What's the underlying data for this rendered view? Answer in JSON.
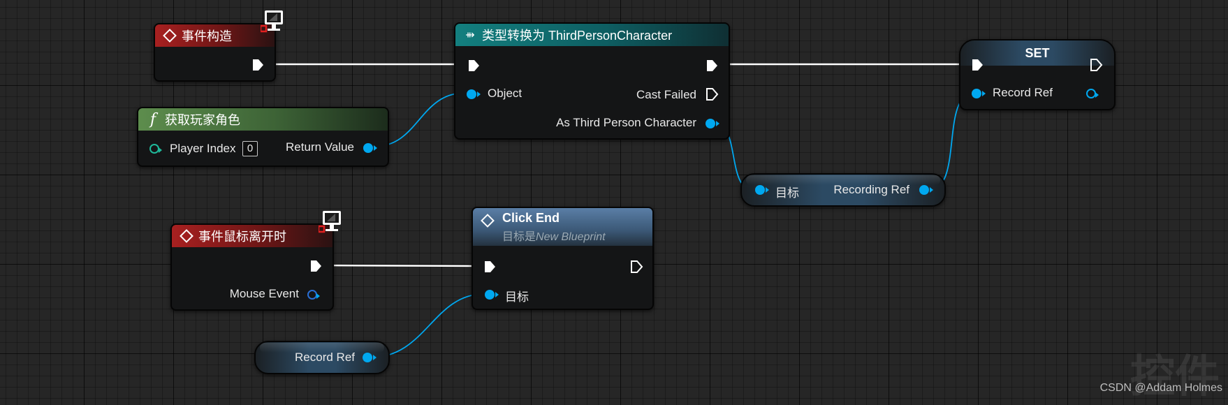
{
  "nodes": {
    "event_construct": {
      "title": "事件构造"
    },
    "cast": {
      "title": "类型转换为 ThirdPersonCharacter",
      "pin_object": "Object",
      "pin_cast_failed": "Cast Failed",
      "pin_as": "As Third Person Character"
    },
    "get_player": {
      "title": "获取玩家角色",
      "pin_player_index": "Player Index",
      "player_index_value": "0",
      "pin_return": "Return Value"
    },
    "set": {
      "title": "SET",
      "pin_record_ref": "Record Ref"
    },
    "recording_getter": {
      "pin_target": "目标",
      "pin_recording_ref": "Recording Ref"
    },
    "mouse_leave": {
      "title": "事件鼠标离开时",
      "pin_mouse_event": "Mouse Event"
    },
    "click_end": {
      "title": "Click End",
      "subtitle_prefix": "目标是",
      "subtitle_class": "New Blueprint",
      "pin_target": "目标"
    },
    "record_ref_var": {
      "label": "Record Ref"
    }
  },
  "watermark": "CSDN @Addam Holmes",
  "background_text": "控件",
  "colors": {
    "object_pin": "#00a8f0",
    "exec_wire": "#ffffff",
    "int_pin": "#1fb89a",
    "event_header": "#a82020",
    "cast_header": "#137f7f",
    "function_header": "#5d8d4d"
  }
}
